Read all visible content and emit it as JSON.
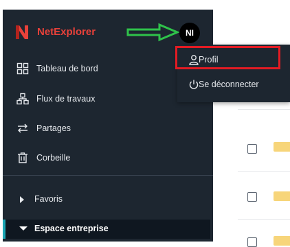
{
  "brand": {
    "name": "NetExplorer",
    "color": "#e8413a"
  },
  "user": {
    "initials": "NI"
  },
  "annotations": {
    "arrow_color": "#2fc24a",
    "highlight_color": "#e31b23"
  },
  "sidebar": {
    "items": [
      {
        "label": "Tableau de bord",
        "icon": "dashboard-grid-icon"
      },
      {
        "label": "Flux de travaux",
        "icon": "workflow-icon"
      },
      {
        "label": "Partages",
        "icon": "share-arrows-icon"
      },
      {
        "label": "Corbeille",
        "icon": "trash-icon"
      }
    ],
    "sections": [
      {
        "label": "Favoris",
        "expanded": false
      },
      {
        "label": "Espace entreprise",
        "expanded": true
      }
    ]
  },
  "user_menu": {
    "items": [
      {
        "label": "Profil",
        "icon": "user-icon"
      },
      {
        "label": "Se déconnecter",
        "icon": "power-icon"
      }
    ]
  }
}
